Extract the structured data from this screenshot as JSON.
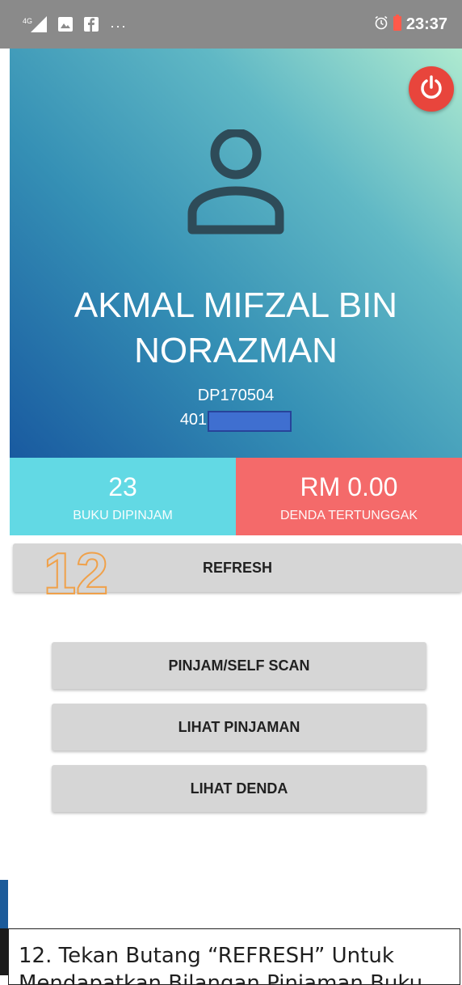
{
  "status_bar": {
    "network": "4G",
    "more": "···",
    "time": "23:37"
  },
  "profile": {
    "name_line1": "AKMAL MIFZAL BIN",
    "name_line2": "NORAZMAN",
    "student_id": "DP170504",
    "ic_prefix": "401",
    "avatar_icon": "person-outline-icon",
    "logout_icon": "power-icon"
  },
  "stats": {
    "books_count": "23",
    "books_label": "BUKU DIPINJAM",
    "fine_amount": "RM 0.00",
    "fine_label": "DENDA TERTUNGGAK"
  },
  "buttons": {
    "refresh": "REFRESH",
    "pinjam": "PINJAM/SELF SCAN",
    "lihat_pinjaman": "LIHAT PINJAMAN",
    "lihat_denda": "LIHAT DENDA"
  },
  "annotation": {
    "step": "12"
  },
  "caption": {
    "line1": "12. Tekan Butang “REFRESH” Untuk",
    "line2": "Mendapatkan Bilangan Pinjaman Buku"
  },
  "colors": {
    "power_button": "#e8453c",
    "books_tile": "#62d9e4",
    "fines_tile": "#f46a6a",
    "redaction": "#3f6fd0"
  }
}
